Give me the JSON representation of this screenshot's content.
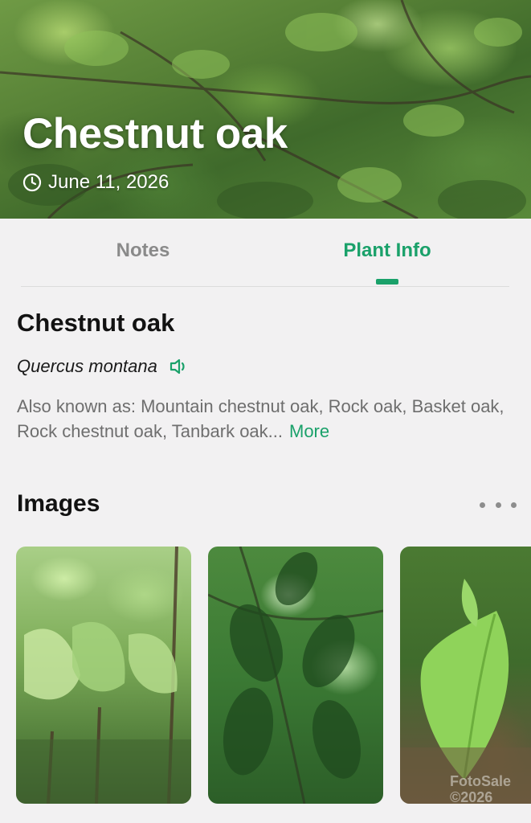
{
  "hero": {
    "title": "Chestnut oak",
    "date": "June 11, 2026"
  },
  "tabs": {
    "notes": "Notes",
    "plant_info": "Plant Info",
    "active": "plant_info"
  },
  "plant": {
    "common_name": "Chestnut oak",
    "scientific_name": "Quercus montana",
    "also_known_as": "Also known as: Mountain chestnut oak, Rock oak, Basket oak, Rock chestnut oak, Tanbark oak...",
    "more_label": "More"
  },
  "images_section": {
    "title": "Images",
    "thumbnails": [
      "oak-tree-forest-photo",
      "oak-branches-leaves-photo",
      "oak-leaf-closeup-photo"
    ]
  },
  "watermark": {
    "line1": "FotoSale",
    "line2": "©2026"
  },
  "colors": {
    "accent": "#1aa16a",
    "inactive_tab": "#8a8a8a",
    "background": "#f2f1f2"
  },
  "icons": [
    "clock-icon",
    "speaker-icon",
    "more-dots-icon"
  ]
}
